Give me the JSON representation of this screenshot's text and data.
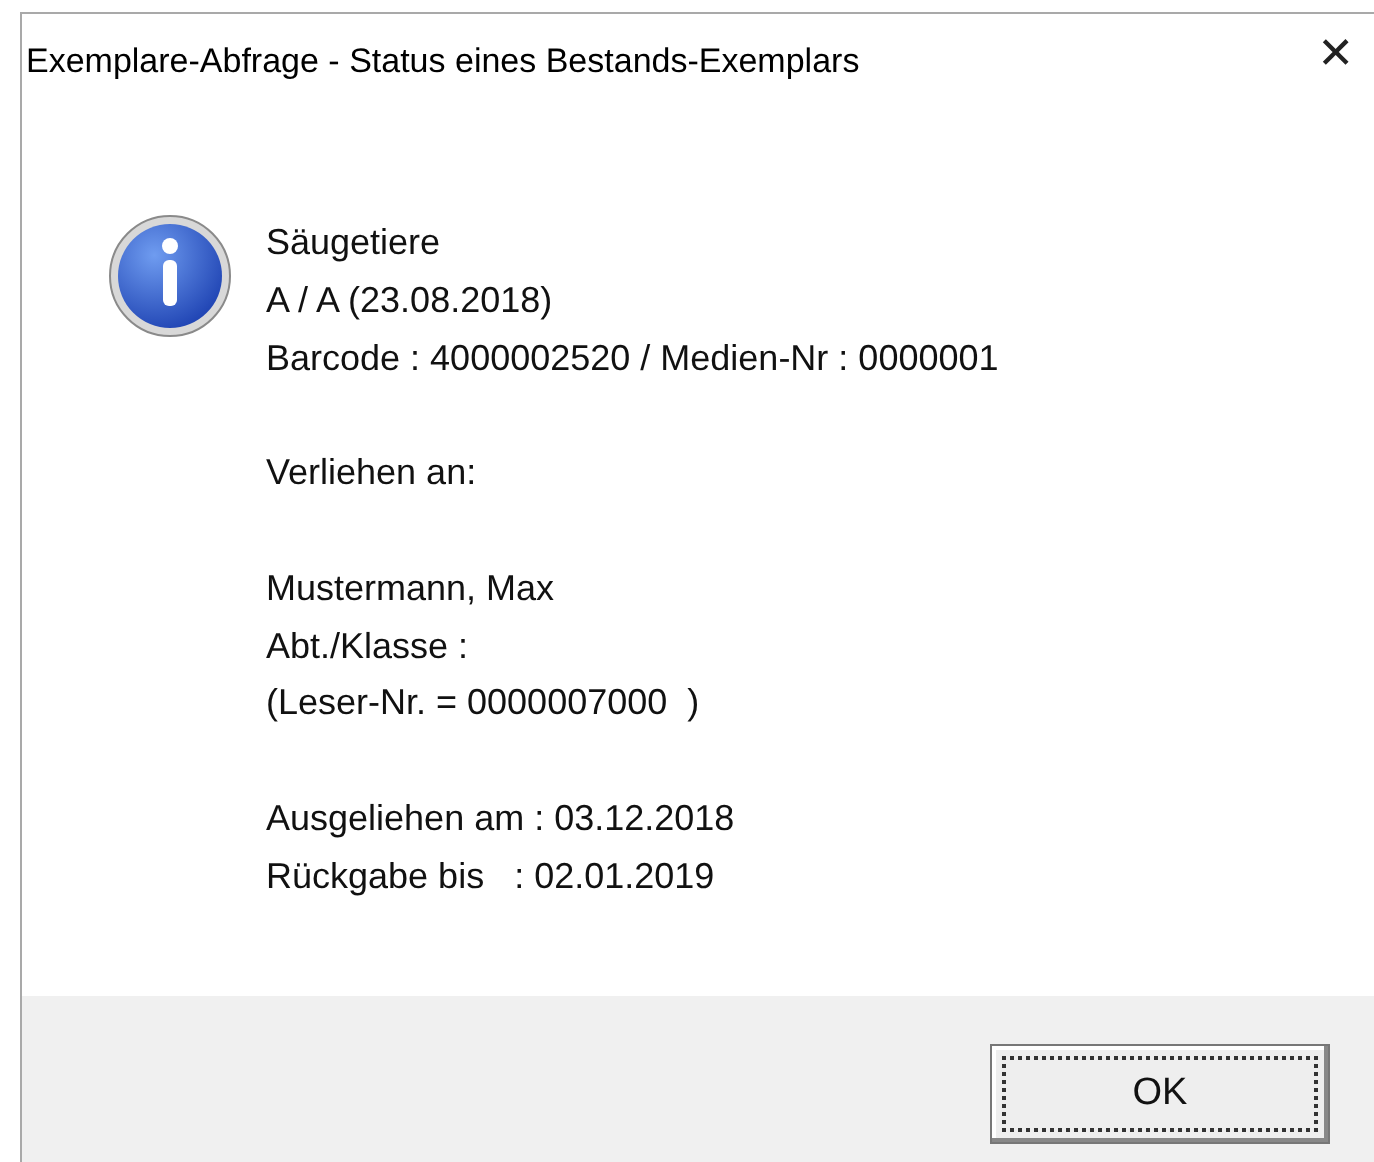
{
  "window": {
    "title": "Exemplare-Abfrage - Status eines Bestands-Exemplars",
    "close": "✕"
  },
  "message": {
    "kind": "info",
    "paragraphs": [
      {
        "lines": [
          "Säugetiere",
          "A / A (23.08.2018)",
          "Barcode : 4000002520 / Medien-Nr : 0000001"
        ]
      },
      {
        "lines": [
          "Verliehen an:"
        ]
      },
      {
        "lines": [
          "Mustermann, Max",
          "Abt./Klasse :",
          "(Leser-Nr. = 0000007000  )"
        ]
      },
      {
        "lines": [
          "Ausgeliehen am : 03.12.2018",
          "Rückgabe bis   : 02.01.2019"
        ]
      }
    ]
  },
  "buttons": [
    {
      "label": "OK",
      "focused": true
    }
  ]
}
